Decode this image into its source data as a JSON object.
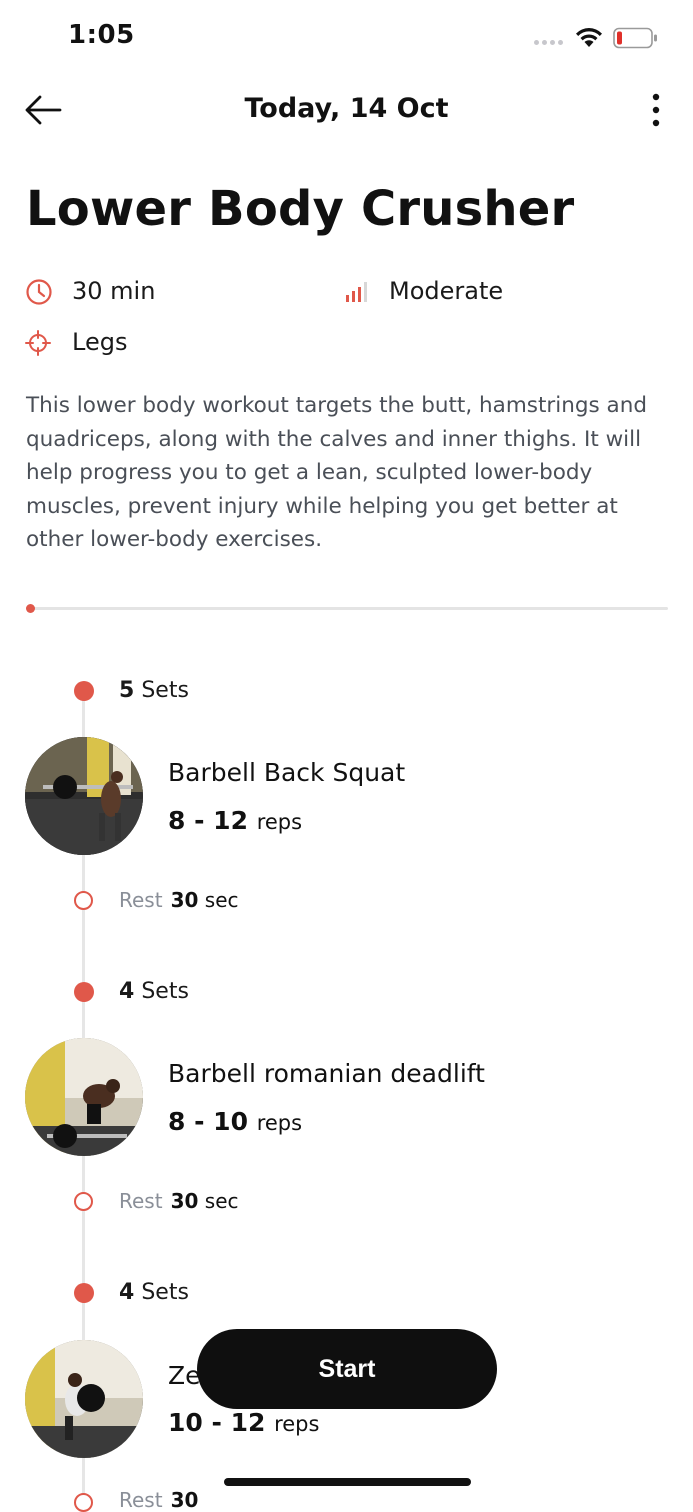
{
  "status_bar": {
    "time": "1:05"
  },
  "header": {
    "title": "Today, 14 Oct"
  },
  "workout": {
    "title": "Lower Body Crusher",
    "duration": "30 min",
    "difficulty": "Moderate",
    "target": "Legs",
    "description": "This lower body workout targets the butt, hamstrings and quadriceps, along with the calves and inner thighs. It will help progress you to get a lean, sculpted lower-body muscles, prevent injury while helping you get better at other lower-body exercises."
  },
  "exercises": [
    {
      "sets_count": "5",
      "sets_unit": "Sets",
      "name": "Barbell Back Squat",
      "reps": "8 - 12",
      "reps_unit": "reps",
      "rest_label": "Rest",
      "rest_value": "30",
      "rest_unit": "sec"
    },
    {
      "sets_count": "4",
      "sets_unit": "Sets",
      "name": "Barbell romanian deadlift",
      "reps": "8 - 10",
      "reps_unit": "reps",
      "rest_label": "Rest",
      "rest_value": "30",
      "rest_unit": "sec"
    },
    {
      "sets_count": "4",
      "sets_unit": "Sets",
      "name": "Ze",
      "reps": "10 - 12",
      "reps_unit": "reps",
      "rest_label": "Rest",
      "rest_value": "30",
      "rest_unit": ""
    }
  ],
  "actions": {
    "start_label": "Start"
  },
  "colors": {
    "accent": "#e0584a",
    "button": "#0f0f0f",
    "text_secondary": "#4a4f57"
  }
}
